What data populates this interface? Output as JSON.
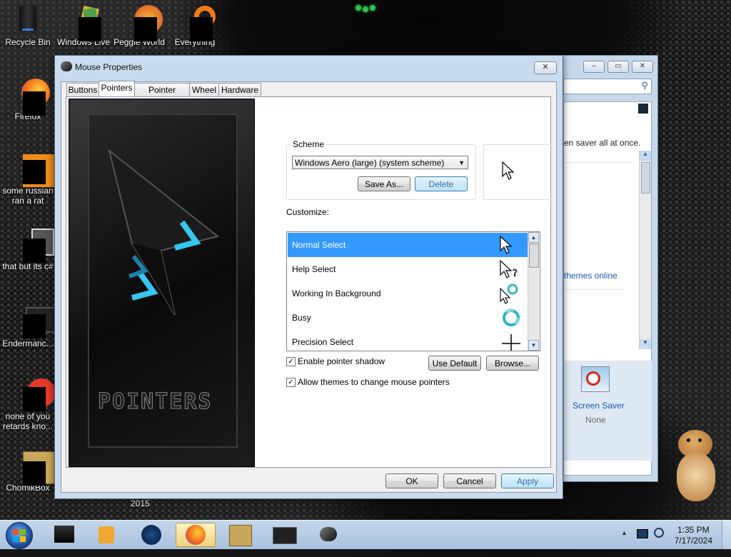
{
  "desktop": {
    "icons": [
      {
        "label": "Recycle Bin"
      },
      {
        "label": "Windows Live"
      },
      {
        "label": "Peggle World"
      },
      {
        "label": "Everything"
      },
      {
        "label": "Firefox"
      },
      {
        "label": "some russian ran a rat"
      },
      {
        "label": "that but its c#"
      },
      {
        "label": "Endermanc..."
      },
      {
        "label": "none of you retards kno..."
      },
      {
        "label": "ChomikBox"
      }
    ],
    "stray_label": "2015"
  },
  "background_window": {
    "partial_text": "en saver all at once.",
    "link_text": "themes online",
    "screen_saver_label": "Screen Saver",
    "screen_saver_value": "None"
  },
  "dialog": {
    "title": "Mouse Properties",
    "close_glyph": "✕",
    "tabs": [
      "Buttons",
      "Pointers",
      "Pointer Options",
      "Wheel",
      "Hardware"
    ],
    "active_tab": "Pointers",
    "banner_text": "POINTERS",
    "scheme": {
      "label": "Scheme",
      "selected": "Windows Aero (large) (system scheme)",
      "save_as": "Save As...",
      "delete": "Delete"
    },
    "customize_label": "Customize:",
    "pointer_list": [
      {
        "name": "Normal Select",
        "icon": "arrow-cursor-icon",
        "selected": true
      },
      {
        "name": "Help Select",
        "icon": "help-cursor-icon",
        "selected": false
      },
      {
        "name": "Working In Background",
        "icon": "working-cursor-icon",
        "selected": false
      },
      {
        "name": "Busy",
        "icon": "busy-ring-icon",
        "selected": false
      },
      {
        "name": "Precision Select",
        "icon": "crosshair-icon",
        "selected": false
      }
    ],
    "enable_shadow": {
      "label": "Enable pointer shadow",
      "checked": true
    },
    "allow_themes": {
      "label": "Allow themes to change mouse pointers",
      "checked": true
    },
    "use_default": "Use Default",
    "browse": "Browse...",
    "ok": "OK",
    "cancel": "Cancel",
    "apply": "Apply"
  },
  "taskbar": {
    "time": "1:35 PM",
    "date": "7/17/2024"
  }
}
